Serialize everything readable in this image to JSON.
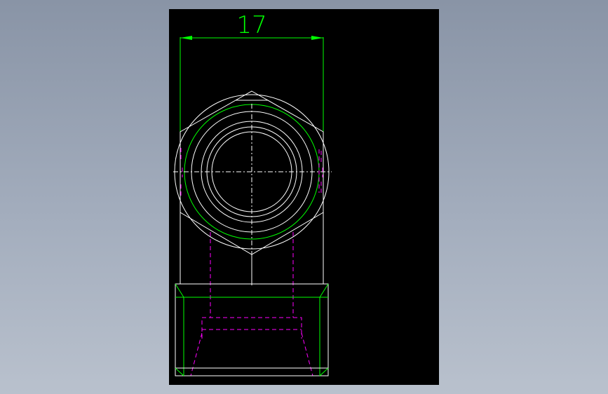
{
  "drawing": {
    "dimension_label": "17",
    "colors": {
      "background_outer": "#98a2b3",
      "sheet": "#000000",
      "geometry": "#ffffff",
      "dimension": "#00ff00",
      "hidden_lines": "#ff00ff",
      "center_lines": "#ffffff"
    }
  }
}
